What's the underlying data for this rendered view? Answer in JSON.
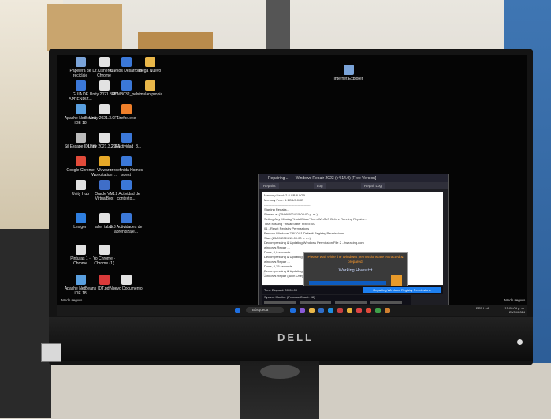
{
  "window": {
    "title": "Repairing ... — Windows Repair 2023 (v4.14.0) [Free Version]",
    "tabs": [
      "Repairs",
      "Log",
      "Repair Log"
    ],
    "log_lines": [
      "Memory Used: 2.8 GB/8.0GB",
      "Memory Free: 5.1GB/8.0GB",
      "--------------------------------------------",
      "Starting Repairs...",
      "    Started at (25/09/2024 15:00:00 p. m.)",
      "Setting Any Missing \"InstallState\" from WinSxS Before Running Repairs...",
      "Total Missing \"InstallState\" Fixed: 00",
      "01 - Reset Registry Permissions",
      "    Restore Windows 7/8/10/11 Default Registry Permissions",
      "    Start (25/09/2024 15:00:00 p. m.)",
      "Decompressing & Updating Windows Permission File 2 ...tweaking.com",
      "    windows Repair ...",
      "Done, 0,0 seconds",
      "Decompressing & Updating ...",
      "    windows Repair ...",
      "Done, 0,25 seconds",
      "Decompressing & Updating Windows Permission File 2: C:\\Program Files (x86)\\Tweaking.com",
      "    windows Repair (All in One)\\files\\permissions\\tokenfile"
    ],
    "popup": {
      "message": "Please wait while the Windows permissions are extracted & prepared.",
      "sub": "Working Hives.txt"
    },
    "status": {
      "time_label": "Time Elapsed: 00:00:09",
      "button_label": "Repairing Windows Registry Permissions",
      "monitor_label": "System Monitor (Process Count: 98)"
    }
  },
  "desktop_icons": [
    {
      "label": "Papelera de reciclaje",
      "color": "#7aa3d8"
    },
    {
      "label": "Dr.Cisneros - Chrome",
      "color": "#e2e2e2"
    },
    {
      "label": "Cursos Desarrollo",
      "color": "#3b78d8"
    },
    {
      "label": "Mega Nuevo",
      "color": "#e9b74a"
    },
    {
      "label": "GUIA DE APRENDIZ...",
      "color": "#3b78d8"
    },
    {
      "label": "Unity 2021.3.8f1",
      "color": "#e2e2e2"
    },
    {
      "label": "PDMB032_pel...",
      "color": "#3b78d8"
    },
    {
      "label": "simulan propia",
      "color": "#e9b74a"
    },
    {
      "label": "Apache NetBeans IDE 18",
      "color": "#5aa0e0"
    },
    {
      "label": "Unity 2021.3.0F1",
      "color": "#e2e2e2"
    },
    {
      "label": "Firefox.exe",
      "color": "#ef7f2a"
    },
    {
      "label": "Sil Escape IDL(In)",
      "color": "#bbbbbb"
    },
    {
      "label": "Unity 2021.3.29F1",
      "color": "#e2e2e2"
    },
    {
      "label": "2.1 Actividad_8...",
      "color": "#3b78d8"
    },
    {
      "label": "Google Chrome",
      "color": "#e24b3a"
    },
    {
      "label": "VMware Workstation ...",
      "color": "#e7a928"
    },
    {
      "label": "predefinida Homes sdest",
      "color": "#3b78d8"
    },
    {
      "label": "Unity Hub",
      "color": "#e2e2e2"
    },
    {
      "label": "Oracle VM VirtualBox",
      "color": "#3f6ec8"
    },
    {
      "label": "3.2 Actividad de contexto...",
      "color": "#3b78d8"
    },
    {
      "label": "Lexigen",
      "color": "#2f7fe0"
    },
    {
      "label": "alter table",
      "color": "#e2e2e2"
    },
    {
      "label": "3.3 Actividades de aprendizaje...",
      "color": "#3b78d8"
    },
    {
      "label": "Pinturas 1 - Chrome",
      "color": "#e2e2e2"
    },
    {
      "label": "Yo Chrome - Chrome (1)",
      "color": "#e2e2e2"
    },
    {
      "label": "Apache NetBeans IDE 18",
      "color": "#5aa0e0"
    },
    {
      "label": "IDT.pdf",
      "color": "#d93a3a"
    },
    {
      "label": "Nuevo Documento ...",
      "color": "#e2e2e2"
    }
  ],
  "top_right_icon": {
    "label": "Internet Explorer",
    "color": "#7aa3d8"
  },
  "taskbar": {
    "search_label": "Búsqueda",
    "icon_colors": [
      "#1e6fe0",
      "#8a5ad8",
      "#e9b74a",
      "#2f6ec8",
      "#1f8de0",
      "#c84040",
      "#e7b13a",
      "#d44",
      "#e24b3a",
      "#3fa04a",
      "#d08030"
    ],
    "lang": "ESP LAA",
    "time": "15:08:09 p. m.",
    "date": "25/09/2024"
  },
  "mode_left": "Modo seguro",
  "mode_right": "Modo seguro",
  "monitor_brand": "DELL"
}
